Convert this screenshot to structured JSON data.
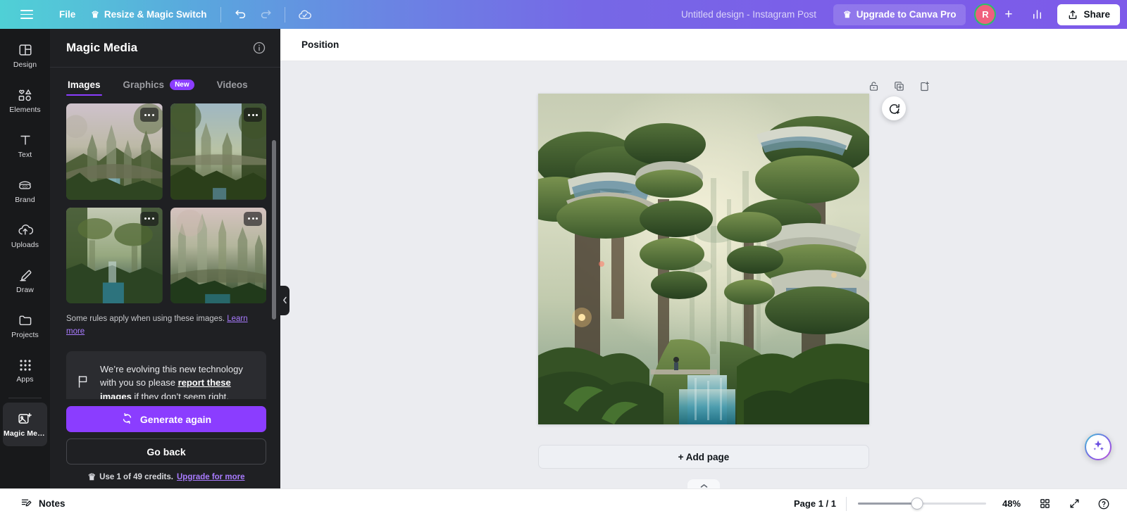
{
  "topbar": {
    "menu_icon": "hamburger-icon",
    "file_label": "File",
    "resize_label": "Resize & Magic Switch",
    "crown_glyph": "♛",
    "undo_icon": "undo-icon",
    "redo_icon": "redo-icon",
    "cloud_icon": "cloud-saved-icon",
    "doc_title": "Untitled design - Instagram Post",
    "upgrade_label": "Upgrade to Canva Pro",
    "avatar_initial": "R",
    "add_member_glyph": "+",
    "insights_icon": "insights-chart-icon",
    "share_label": "Share",
    "accent_purple": "#8b3dff",
    "avatar_color": "#f0607e",
    "avatar_ring_color": "#2bbf6a"
  },
  "rail": {
    "items": [
      {
        "id": "design",
        "label": "Design",
        "icon": "design-icon",
        "active": false
      },
      {
        "id": "elements",
        "label": "Elements",
        "icon": "elements-icon",
        "active": false
      },
      {
        "id": "text",
        "label": "Text",
        "icon": "text-icon",
        "active": false
      },
      {
        "id": "brand",
        "label": "Brand",
        "icon": "brand-icon",
        "active": false
      },
      {
        "id": "uploads",
        "label": "Uploads",
        "icon": "uploads-icon",
        "active": false
      },
      {
        "id": "draw",
        "label": "Draw",
        "icon": "draw-icon",
        "active": false
      },
      {
        "id": "projects",
        "label": "Projects",
        "icon": "projects-folder-icon",
        "active": false
      },
      {
        "id": "apps",
        "label": "Apps",
        "icon": "apps-grid-icon",
        "active": false
      }
    ],
    "active_item": {
      "id": "magic-media",
      "label": "Magic Med...",
      "icon": "magic-media-icon"
    }
  },
  "panel": {
    "title": "Magic Media",
    "info_icon": "info-icon",
    "tabs": [
      {
        "id": "images",
        "label": "Images",
        "badge": "",
        "active": true
      },
      {
        "id": "graphics",
        "label": "Graphics",
        "badge": "New",
        "active": false
      },
      {
        "id": "videos",
        "label": "Videos",
        "badge": "",
        "active": false
      }
    ],
    "results": [
      {
        "id": "result-1",
        "alt": "Fantasy forest city with spires and bridge",
        "menu_icon": "more-options-icon"
      },
      {
        "id": "result-2",
        "alt": "Overgrown green canyon city",
        "menu_icon": "more-options-icon"
      },
      {
        "id": "result-3",
        "alt": "Forest city with waterfall and lake",
        "menu_icon": "more-options-icon"
      },
      {
        "id": "result-4",
        "alt": "Tall towers above a misty jungle",
        "menu_icon": "more-options-icon"
      }
    ],
    "rules_text": "Some rules apply when using these images. ",
    "rules_link": "Learn more",
    "notice": {
      "icon": "flag-icon",
      "part1": "We’re evolving this new technology with you so please ",
      "link": "report these images",
      "part2": " if they don’t seem right."
    },
    "generate_label": "Generate again",
    "generate_icon": "regenerate-icon",
    "go_back_label": "Go back",
    "credits_crown": "♛",
    "credits_text": "Use 1 of 49 credits. ",
    "credits_link": "Upgrade for more",
    "collapse_icon": "chevron-left-icon",
    "scrollbar": "panel-scrollbar"
  },
  "editor": {
    "context_label": "Position",
    "page_tools": [
      {
        "id": "lock",
        "icon": "lock-icon"
      },
      {
        "id": "duplicate",
        "icon": "duplicate-page-icon"
      },
      {
        "id": "add",
        "icon": "add-page-after-icon"
      }
    ],
    "magic_fab_icon": "magic-comment-icon",
    "page_alt": "Solarpunk forest city with canopy platforms over a turquoise river",
    "add_page_label": "+ Add page",
    "collapse_tab_icon": "chevron-up-icon",
    "magic_studio_icon": "sparkles-icon"
  },
  "statusbar": {
    "notes_icon": "notes-icon",
    "notes_label": "Notes",
    "page_count": "Page 1 / 1",
    "zoom_percent": "48%",
    "zoom_value": 48,
    "grid_icon": "grid-view-icon",
    "fullscreen_icon": "fullscreen-icon",
    "help_icon": "help-icon"
  }
}
